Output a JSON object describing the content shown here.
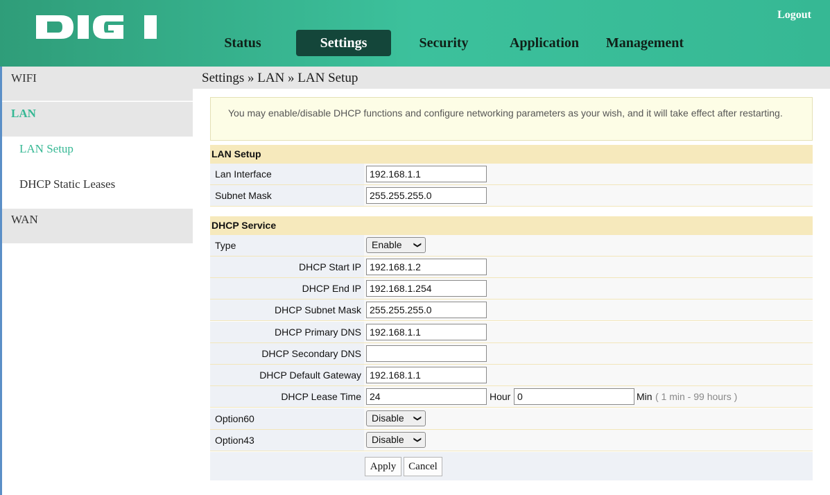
{
  "brand": {
    "logo_text": "DIGI",
    "accent": "#36b894",
    "header_dark": "#14463a"
  },
  "header": {
    "logout": "Logout"
  },
  "nav": [
    "Status",
    "Settings",
    "Security",
    "Application",
    "Management"
  ],
  "sidebar": {
    "wifi": "WIFI",
    "lan": "LAN",
    "lan_setup": "LAN Setup",
    "dhcp_static": "DHCP Static Leases",
    "wan": "WAN"
  },
  "breadcrumb": "Settings » LAN » LAN Setup",
  "notice": "You may enable/disable DHCP functions and configure networking parameters as your wish, and it will take effect after restarting.",
  "lan_setup": {
    "title": "LAN Setup",
    "lan_interface_label": "Lan Interface",
    "lan_interface_value": "192.168.1.1",
    "subnet_mask_label": "Subnet Mask",
    "subnet_mask_value": "255.255.255.0"
  },
  "dhcp": {
    "title": "DHCP Service",
    "type_label": "Type",
    "type_value": "Enable",
    "start_ip_label": "DHCP Start IP",
    "start_ip_value": "192.168.1.2",
    "end_ip_label": "DHCP End IP",
    "end_ip_value": "192.168.1.254",
    "subnet_label": "DHCP Subnet Mask",
    "subnet_value": "255.255.255.0",
    "primary_dns_label": "DHCP Primary DNS",
    "primary_dns_value": "192.168.1.1",
    "secondary_dns_label": "DHCP Secondary DNS",
    "secondary_dns_value": "",
    "gateway_label": "DHCP Default Gateway",
    "gateway_value": "192.168.1.1",
    "lease_label": "DHCP Lease Time",
    "lease_hour_value": "24",
    "hour_unit": "Hour",
    "lease_min_value": "0",
    "min_unit": "Min",
    "lease_hint": "( 1 min - 99 hours )",
    "option60_label": "Option60",
    "option60_value": "Disable",
    "option43_label": "Option43",
    "option43_value": "Disable"
  },
  "buttons": {
    "apply": "Apply",
    "cancel": "Cancel"
  }
}
